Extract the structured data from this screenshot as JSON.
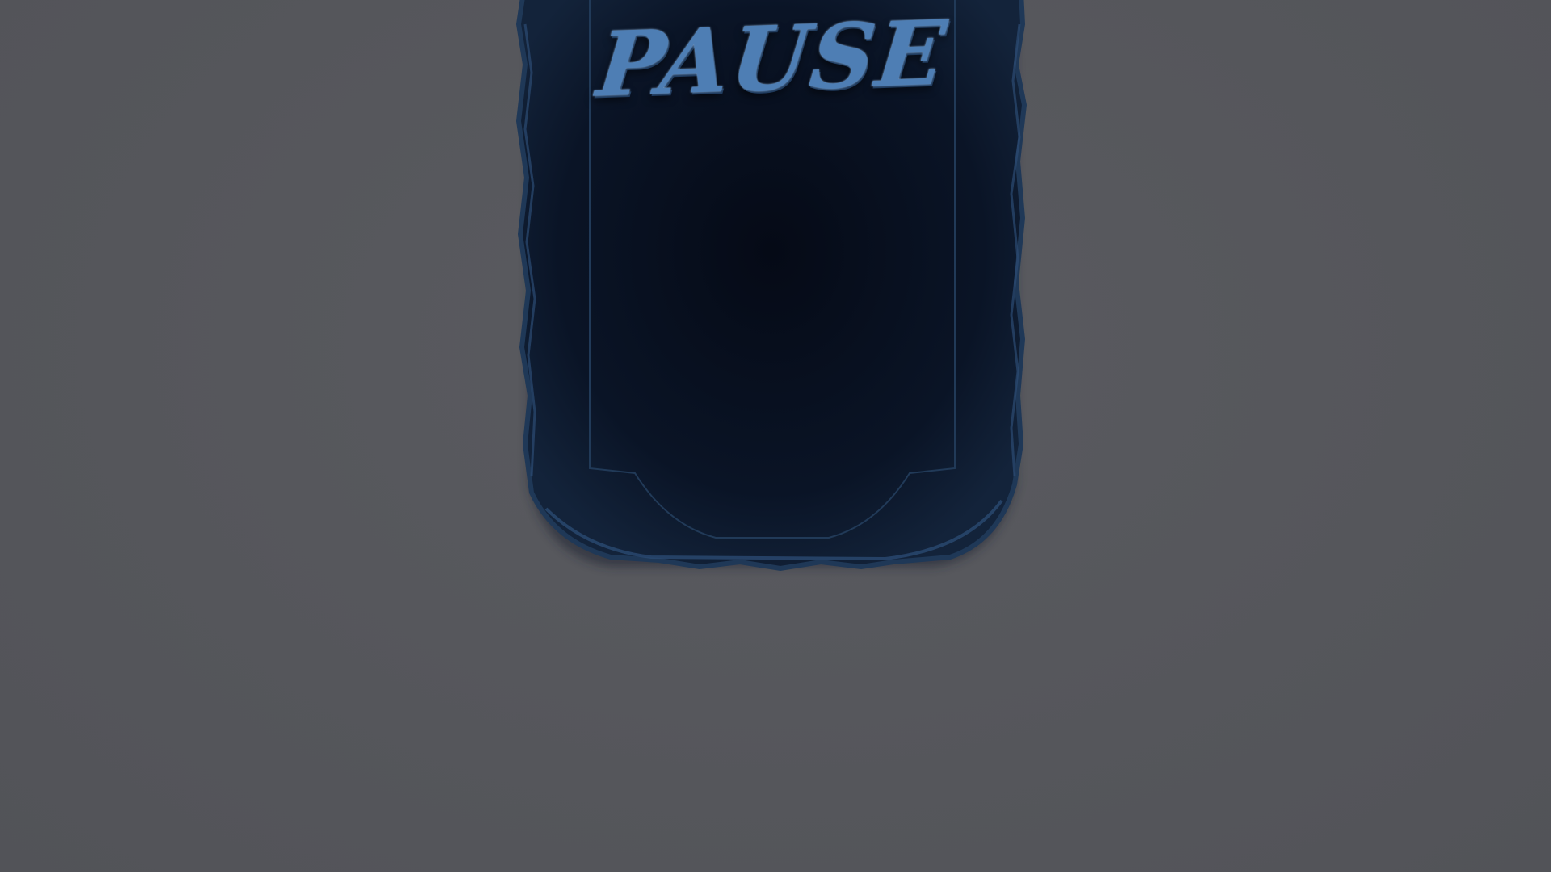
{
  "screen": {
    "title": "PAUSE",
    "background_color": "#55565b",
    "panel_color": "#0c1627",
    "panel_border_color": "#2a4a72",
    "title_color": "#4e7eb4"
  }
}
